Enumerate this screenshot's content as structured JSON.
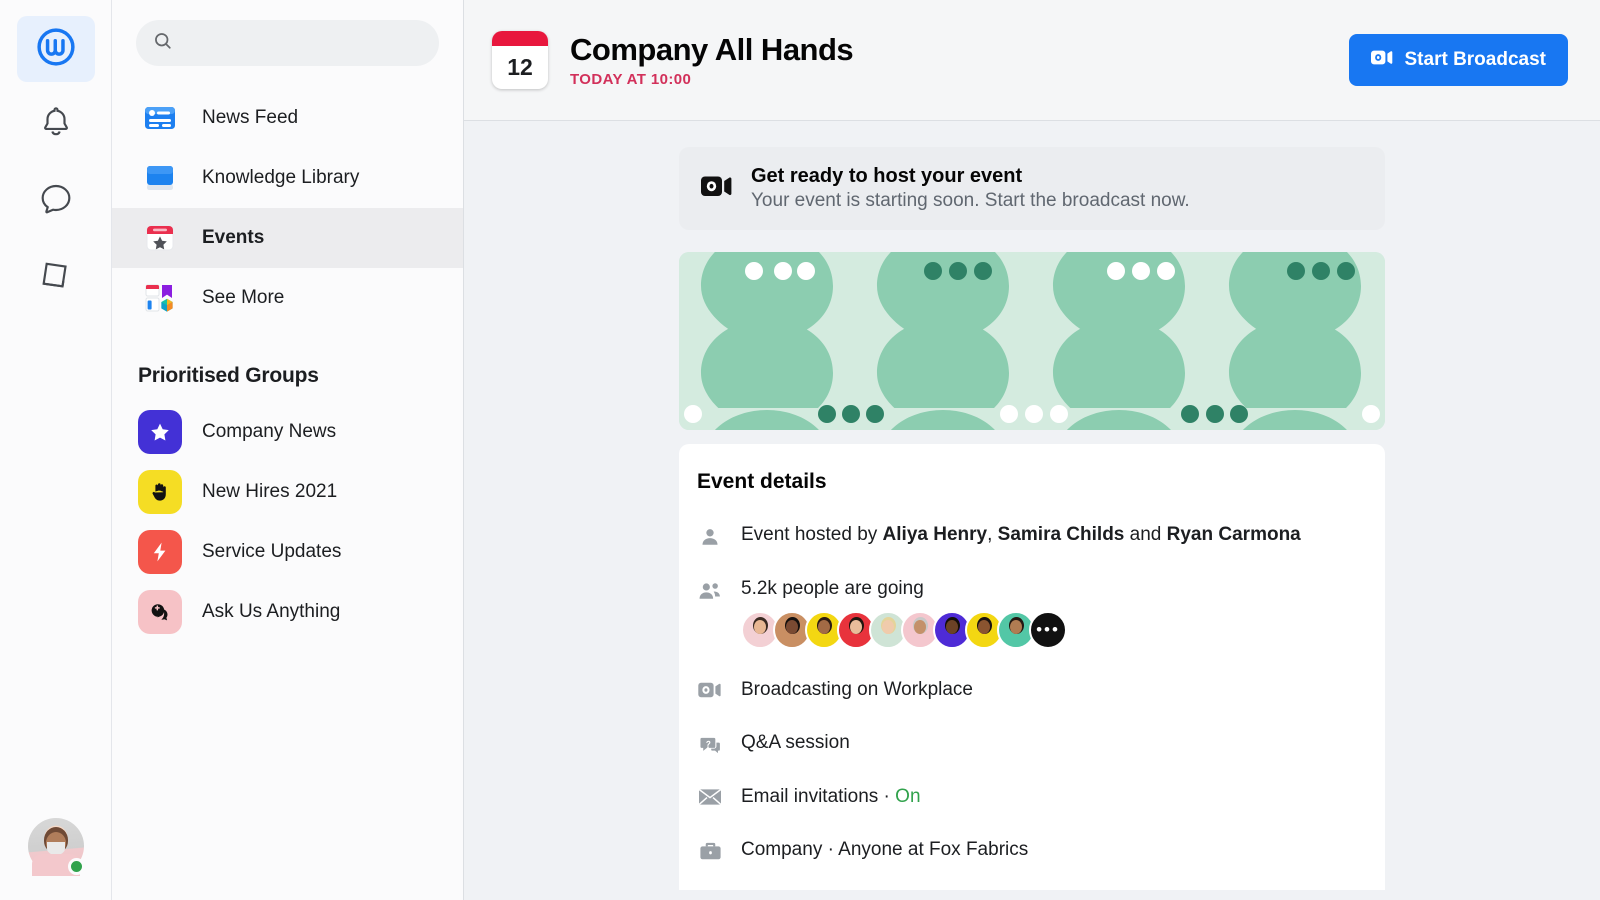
{
  "rail": {
    "items": [
      {
        "name": "workplace-home",
        "icon": "workplace-logo-icon",
        "active": true
      },
      {
        "name": "notifications",
        "icon": "bell-icon",
        "active": false
      },
      {
        "name": "chat",
        "icon": "chat-bubble-icon",
        "active": false
      },
      {
        "name": "library",
        "icon": "book-icon",
        "active": false
      }
    ],
    "avatar": {
      "name": "user-avatar",
      "status": "online"
    }
  },
  "search": {
    "value": "",
    "placeholder": "",
    "icon": "search-icon"
  },
  "nav": {
    "items": [
      {
        "label": "News Feed",
        "icon": "news-feed-icon",
        "active": false
      },
      {
        "label": "Knowledge Library",
        "icon": "knowledge-library-icon",
        "active": false
      },
      {
        "label": "Events",
        "icon": "events-calendar-icon",
        "active": true
      },
      {
        "label": "See More",
        "icon": "see-more-icon",
        "active": false
      }
    ]
  },
  "groups": {
    "title": "Prioritised Groups",
    "items": [
      {
        "label": "Company News",
        "glyph": "★",
        "bg": "#4331d6",
        "icon": "star-icon"
      },
      {
        "label": "New Hires 2021",
        "glyph": "✋",
        "bg": "#f5dd24",
        "icon": "wave-hand-icon"
      },
      {
        "label": "Service Updates",
        "glyph": "⚡",
        "bg": "#f4564b",
        "icon": "lightning-bolt-icon"
      },
      {
        "label": "Ask Us Anything",
        "glyph": "➕",
        "bg": "#f6c2c6",
        "icon": "question-bubble-icon"
      }
    ]
  },
  "header": {
    "calendar_day": "12",
    "title": "Company All Hands",
    "subtitle": "TODAY AT 10:00",
    "broadcast_button": "Start Broadcast",
    "accent": "#1877f2",
    "subtitle_color": "#d2305a"
  },
  "notice": {
    "icon": "video-camera-icon",
    "title": "Get ready to host your event",
    "subtitle": "Your event is starting soon. Start the broadcast now."
  },
  "cover": {
    "alt": "speech-bubble-pattern-cover",
    "bg": "#d4ebdf",
    "bubble": "#8ccdb0",
    "dot_dark": "#2f8266",
    "dot_light": "#ffffff"
  },
  "details": {
    "title": "Event details",
    "rows": [
      {
        "icon": "person-icon",
        "parts": [
          {
            "t": "Event hosted by ",
            "b": false
          },
          {
            "t": "Aliya Henry",
            "b": true
          },
          {
            "t": ", ",
            "b": false
          },
          {
            "t": "Samira Childs",
            "b": true
          },
          {
            "t": " and ",
            "b": false
          },
          {
            "t": "Ryan Carmona",
            "b": true
          }
        ]
      },
      {
        "icon": "people-icon",
        "parts": [
          {
            "t": "5.2k people are going",
            "b": false
          }
        ],
        "avatars": [
          {
            "skin": "#e8b793",
            "hair": "#3a2a22",
            "shirt": "#f3d0d4"
          },
          {
            "skin": "#7a4a32",
            "hair": "#15100e",
            "shirt": "#c98f63"
          },
          {
            "skin": "#a26a45",
            "hair": "#2b1a12",
            "shirt": "#f3d712"
          },
          {
            "skin": "#e9bd9a",
            "hair": "#20160f",
            "shirt": "#e8333c"
          },
          {
            "skin": "#f0cbac",
            "hair": "#e4d49a",
            "shirt": "#cfe4d6"
          },
          {
            "skin": "#c4916a",
            "hair": "#c9c9c9",
            "shirt": "#f4c7ce"
          },
          {
            "skin": "#6b4226",
            "hair": "#120d0a",
            "shirt": "#4e2bd6"
          },
          {
            "skin": "#8a5430",
            "hair": "#181210",
            "shirt": "#f3d712"
          },
          {
            "skin": "#b07c52",
            "hair": "#241812",
            "shirt": "#53c7a6"
          }
        ],
        "more_label": "•••"
      },
      {
        "icon": "video-camera-icon",
        "parts": [
          {
            "t": "Broadcasting on Workplace",
            "b": false
          }
        ]
      },
      {
        "icon": "question-bubble-icon",
        "parts": [
          {
            "t": "Q&A session",
            "b": false
          }
        ]
      },
      {
        "icon": "envelope-icon",
        "parts": [
          {
            "t": "Email invitations · ",
            "b": false
          },
          {
            "t": "On",
            "b": false,
            "green": true
          }
        ]
      },
      {
        "icon": "briefcase-icon",
        "parts": [
          {
            "t": "Company · Anyone at Fox Fabrics",
            "b": false
          }
        ]
      }
    ]
  }
}
